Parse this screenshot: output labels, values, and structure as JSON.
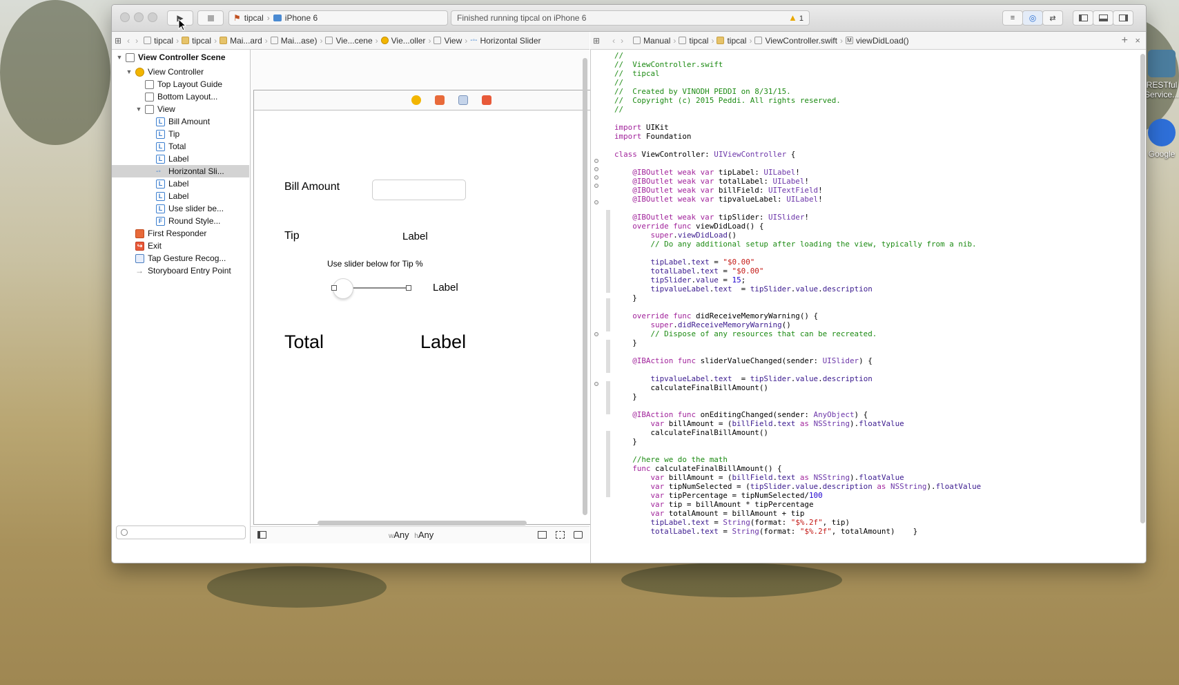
{
  "desktop": {
    "icons": [
      {
        "label": "RESTful Service..."
      },
      {
        "label": "Google"
      }
    ]
  },
  "toolbar": {
    "scheme_project": "tipcal",
    "scheme_device": "iPhone 6",
    "status_text": "Finished running tipcal on iPhone 6",
    "warning_count": "1"
  },
  "left_jumpbar": {
    "crumbs": [
      "tipcal",
      "tipcal",
      "Mai...ard",
      "Mai...ase)",
      "Vie...cene",
      "Vie...oller",
      "View",
      "Horizontal Slider"
    ]
  },
  "right_jumpbar": {
    "crumbs": [
      "Manual",
      "tipcal",
      "tipcal",
      "ViewController.swift",
      "viewDidLoad()"
    ]
  },
  "navigator": {
    "scene_title": "View Controller Scene",
    "items": [
      {
        "label": "View Controller"
      },
      {
        "label": "Top Layout Guide"
      },
      {
        "label": "Bottom Layout..."
      },
      {
        "label": "View"
      },
      {
        "label": "Bill Amount"
      },
      {
        "label": "Tip"
      },
      {
        "label": "Total"
      },
      {
        "label": "Label"
      },
      {
        "label": "Horizontal Sli..."
      },
      {
        "label": "Label"
      },
      {
        "label": "Label"
      },
      {
        "label": "Use slider be..."
      },
      {
        "label": "Round Style..."
      },
      {
        "label": "First Responder"
      },
      {
        "label": "Exit"
      },
      {
        "label": "Tap Gesture Recog..."
      },
      {
        "label": "Storyboard Entry Point"
      }
    ]
  },
  "canvas": {
    "bill_amount_label": "Bill Amount",
    "tip_label": "Tip",
    "tip_value_label": "Label",
    "slider_hint": "Use slider below for Tip %",
    "slider_value_label": "Label",
    "total_label": "Total",
    "total_value_label": "Label",
    "size_class_w": "w",
    "size_class_w_value": "Any",
    "size_class_h": "h",
    "size_class_h_value": "Any"
  }
}
